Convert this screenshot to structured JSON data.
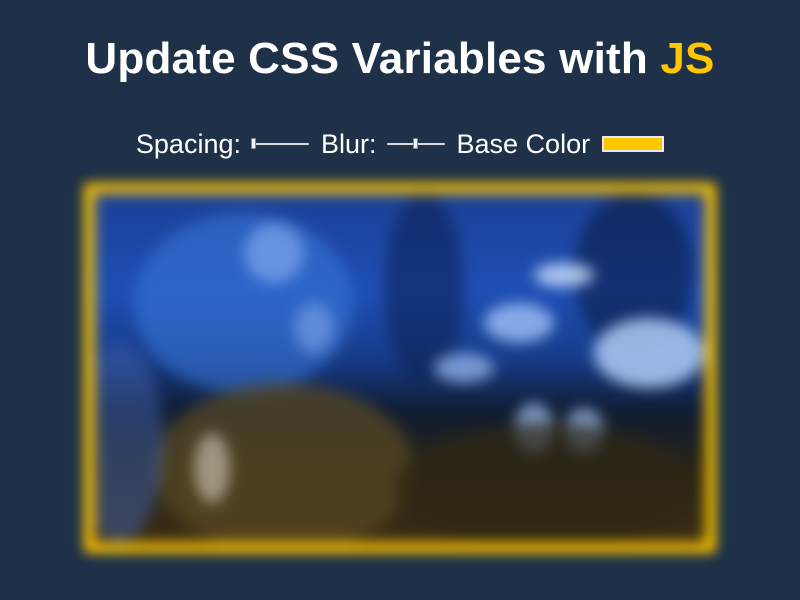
{
  "title": {
    "text_before": "Update CSS Variables with ",
    "highlight": "JS"
  },
  "controls": {
    "spacing_label": "Spacing:",
    "spacing_value": 0.0,
    "blur_label": "Blur:",
    "blur_value": 0.5,
    "base_color_label": "Base Color",
    "base_color_value": "#ffc600"
  },
  "colors": {
    "background": "#1e3148",
    "accent": "#ffc600"
  }
}
